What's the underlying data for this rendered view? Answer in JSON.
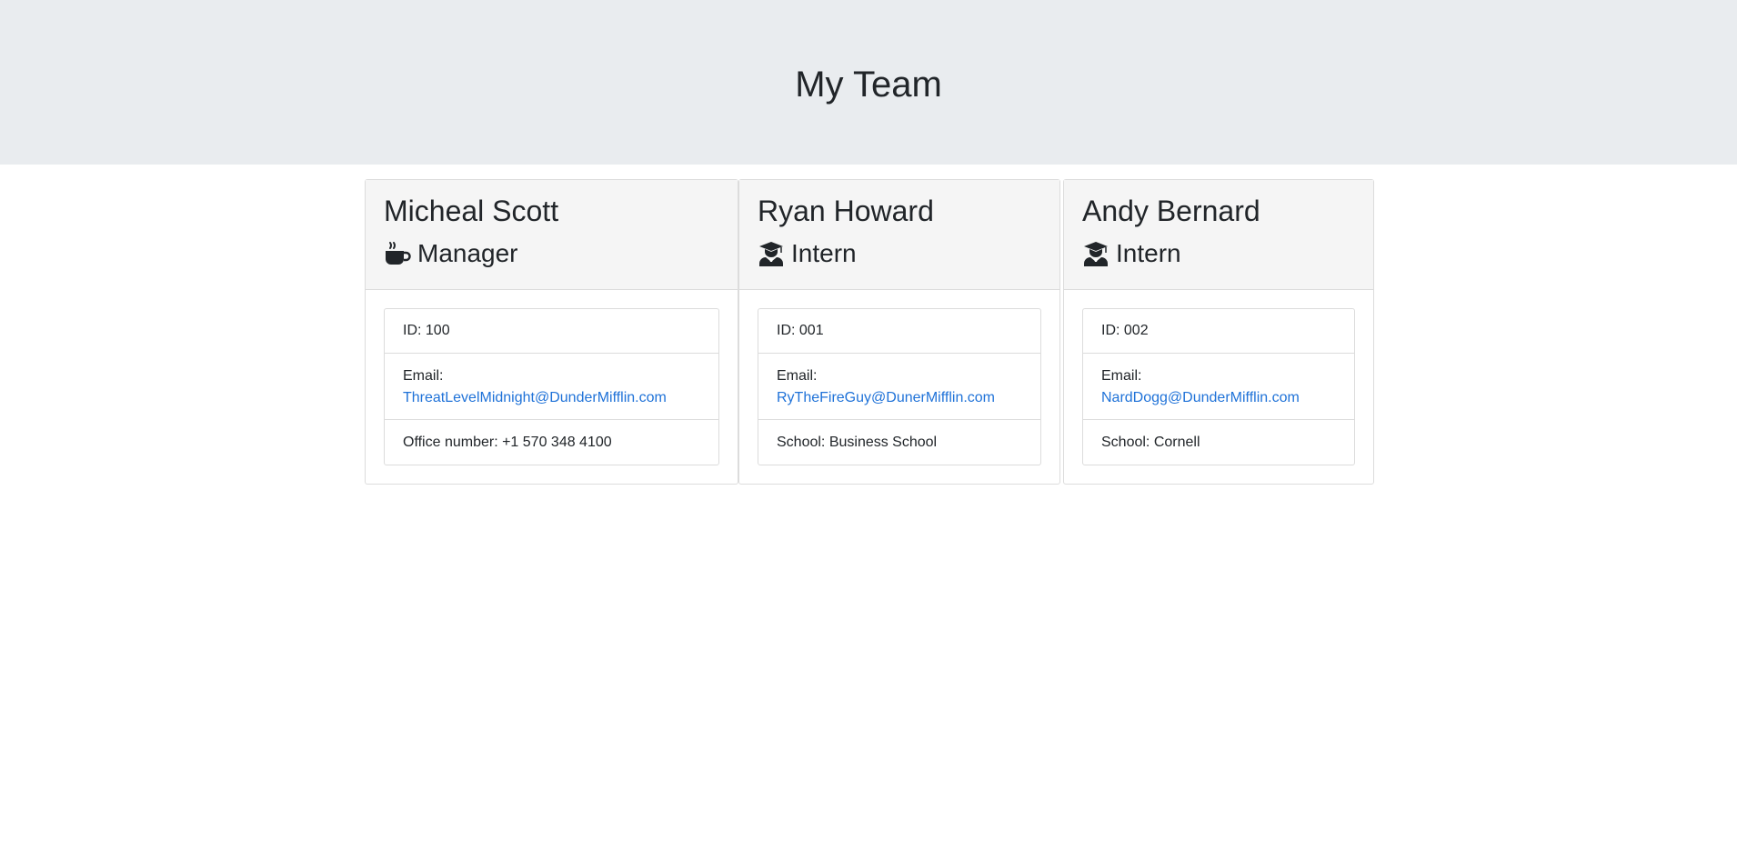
{
  "header": {
    "title": "My Team"
  },
  "colors": {
    "jumbotron_bg": "#e9ecef",
    "link": "#1f72d8",
    "card_header_bg": "#f5f5f5"
  },
  "employees": [
    {
      "name": "Micheal Scott",
      "role": "Manager",
      "role_icon": "coffee-mug-icon",
      "id_text": "ID: 100",
      "email_label": "Email:",
      "email": "ThreatLevelMidnight@DunderMifflin.com",
      "extra": "Office number: +1 570 348 4100"
    },
    {
      "name": "Ryan Howard",
      "role": "Intern",
      "role_icon": "graduate-icon",
      "id_text": "ID: 001",
      "email_label": "Email:",
      "email": "RyTheFireGuy@DunerMifflin.com",
      "extra": "School: Business School"
    },
    {
      "name": "Andy Bernard",
      "role": "Intern",
      "role_icon": "graduate-icon",
      "id_text": "ID: 002",
      "email_label": "Email:",
      "email": "NardDogg@DunderMifflin.com",
      "extra": "School: Cornell"
    }
  ]
}
